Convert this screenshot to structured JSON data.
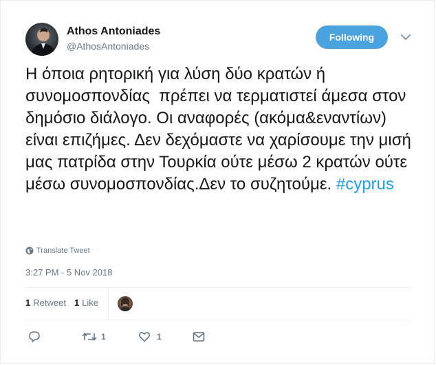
{
  "author": {
    "display_name": "Athos Antoniades",
    "handle": "@AthosAntoniades"
  },
  "follow_button": {
    "label": "Following"
  },
  "tweet": {
    "text": "Η όποια ρητορική για λύση δύο κρατών ή συνομοσπονδίας  πρέπει να τερματιστεί άμεσα στον δημόσιο διάλογο. Οι αναφορές (ακόμα&εναντίων) είναι επιζήμες. Δεν δεχόμαστε να χαρίσουμε την μισή μας πατρίδα στην Τουρκία ούτε μέσω 2 κρατών ούτε μέσω συνομοσπονδίας.Δεν το συζητούμε. ",
    "hashtag": "#cyprus",
    "translate_label": "Translate Tweet",
    "timestamp": "3:27 PM - 5 Nov 2018"
  },
  "stats": {
    "retweets_count": "1",
    "retweets_label": "Retweet",
    "likes_count": "1",
    "likes_label": "Like"
  },
  "actions": {
    "retweet_count": "1",
    "like_count": "1"
  },
  "colors": {
    "accent": "#1da1f2",
    "follow_button": "#4aa3df",
    "secondary_text": "#657786"
  },
  "icons": [
    "globe-icon",
    "chevron-down-icon",
    "reply-icon",
    "retweet-icon",
    "heart-icon",
    "message-icon"
  ]
}
